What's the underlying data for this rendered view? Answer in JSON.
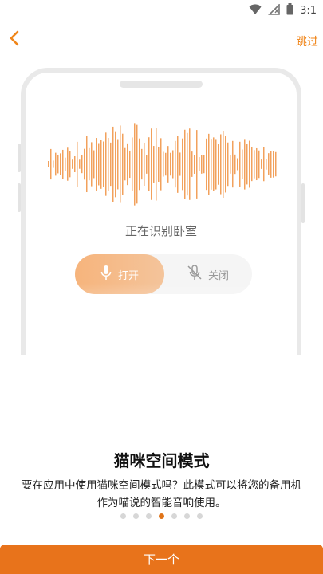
{
  "status_bar": {
    "time": "3:1"
  },
  "header": {
    "skip_label": "跳过"
  },
  "illustration": {
    "recognizing_text": "正在识别卧室",
    "toggle": {
      "on_label": "打开",
      "off_label": "关闭",
      "selected": "on"
    }
  },
  "content": {
    "title": "猫咪空间模式",
    "description_line1": "要在应用中使用猫咪空间模式吗？此模式可以将您的备用机",
    "description_line2": "作为喵说的智能音响使用。"
  },
  "pagination": {
    "total": 7,
    "current_index": 3
  },
  "footer": {
    "next_label": "下一个"
  },
  "colors": {
    "accent": "#F08519",
    "button": "#E8731B",
    "waveform": "#F2A15C",
    "toggle_on": "#F6B47C",
    "dot_active": "#E07419",
    "dot_inactive": "#D7D7D7"
  }
}
